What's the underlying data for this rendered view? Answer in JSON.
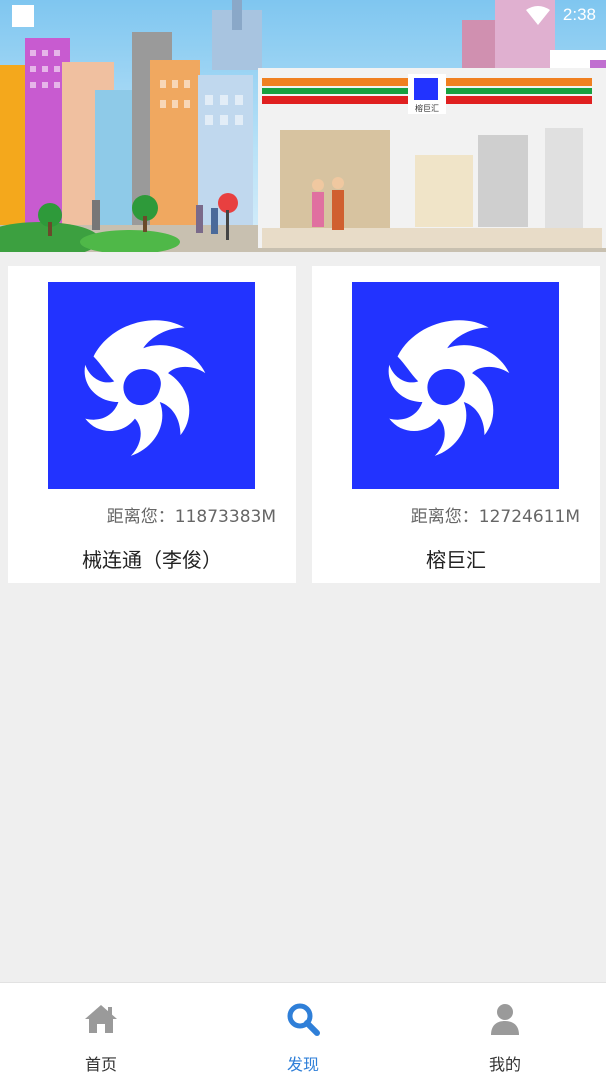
{
  "status_bar": {
    "time": "2:38"
  },
  "banner": {
    "store_sign": "榕巨汇"
  },
  "stores": [
    {
      "name": "械连通（李俊）",
      "distance_label": "距离您：11873383M"
    },
    {
      "name": "榕巨汇",
      "distance_label": "距离您：12724611M"
    }
  ],
  "nav": {
    "items": [
      {
        "label": "首页",
        "icon": "home-icon"
      },
      {
        "label": "发现",
        "icon": "search-icon",
        "active": true
      },
      {
        "label": "我的",
        "icon": "user-icon"
      }
    ]
  },
  "colors": {
    "logo_bg": "#2233ff",
    "active_nav": "#2f7fd8",
    "inactive_icon": "#9a9a9a",
    "page_bg": "#efefef"
  }
}
